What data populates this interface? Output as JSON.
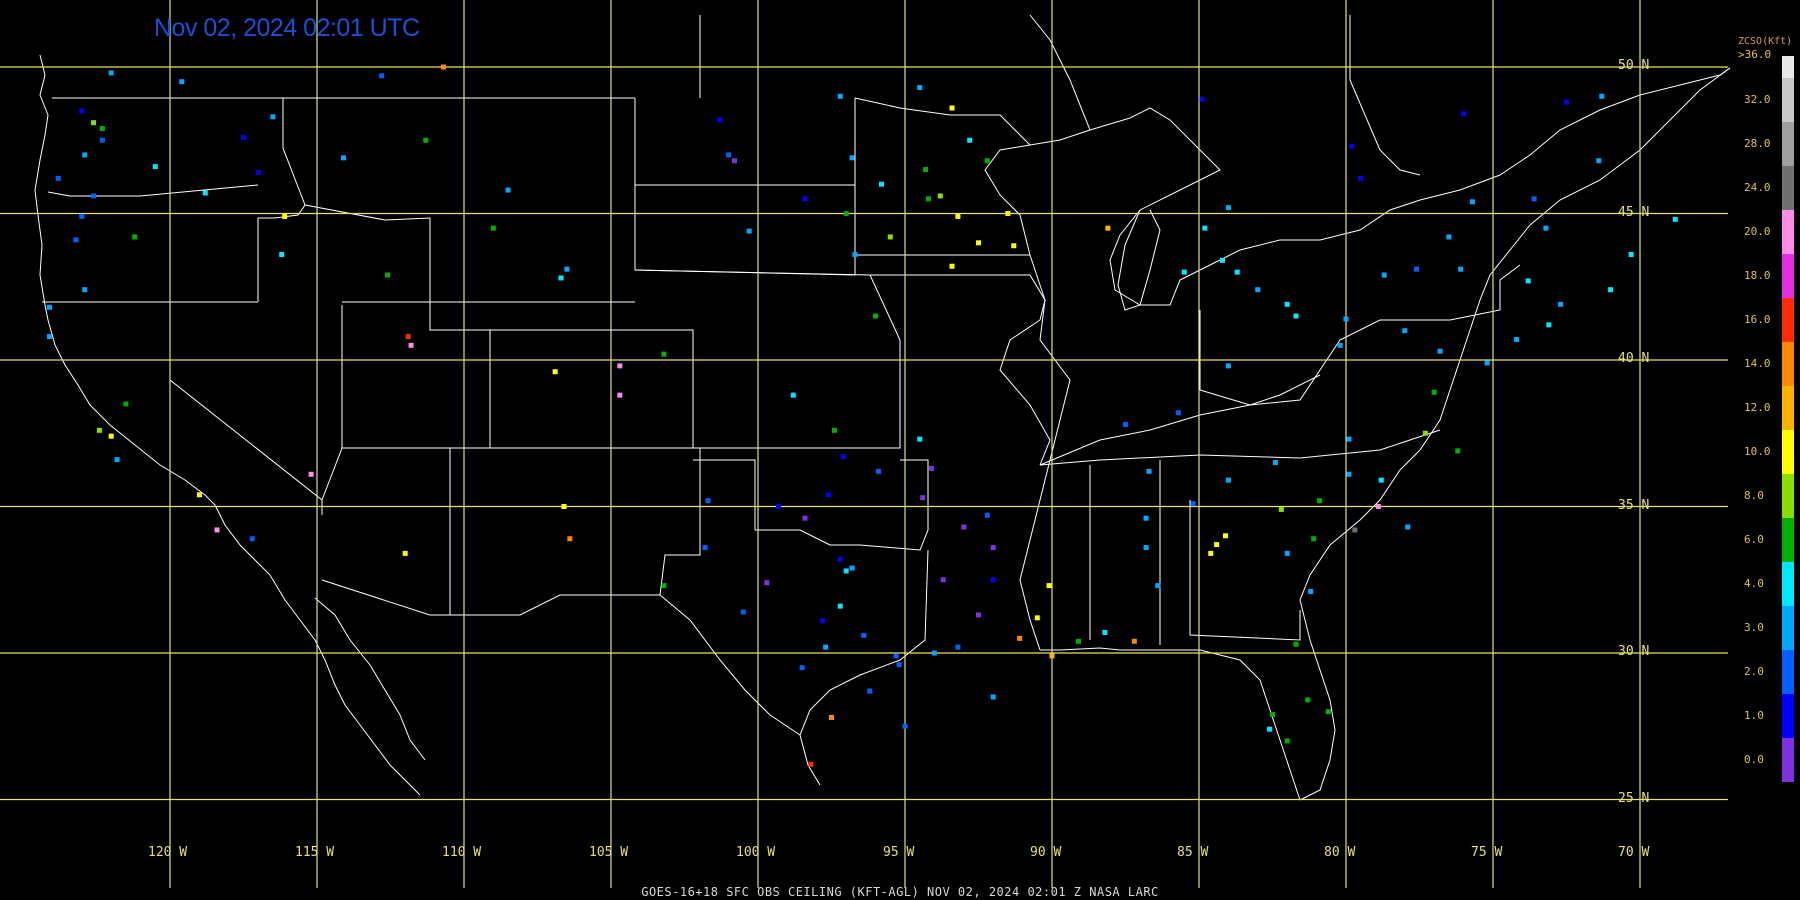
{
  "timestamp": "Nov 02, 2024 02:01 UTC",
  "footer": "GOES-16+18  SFC OBS CEILING (KFT-AGL)  NOV 02, 2024 02:01 Z  NASA LARC",
  "legend": {
    "title": "ZCSO(Kft)",
    "top_label": ">36.0",
    "levels": [
      {
        "label": "32.0",
        "color": "#c8c8c8"
      },
      {
        "label": "28.0",
        "color": "#a0a0a0"
      },
      {
        "label": "24.0",
        "color": "#707070"
      },
      {
        "label": "20.0",
        "color": "#ff8ce8"
      },
      {
        "label": "18.0",
        "color": "#e030e0"
      },
      {
        "label": "16.0",
        "color": "#ff2a00"
      },
      {
        "label": "14.0",
        "color": "#ff8800"
      },
      {
        "label": "12.0",
        "color": "#ffb000"
      },
      {
        "label": "10.0",
        "color": "#ffff00"
      },
      {
        "label": "8.0",
        "color": "#88e000"
      },
      {
        "label": "6.0",
        "color": "#00b000"
      },
      {
        "label": "4.0",
        "color": "#00e8ff"
      },
      {
        "label": "3.0",
        "color": "#00a8ff"
      },
      {
        "label": "2.0",
        "color": "#0060ff"
      },
      {
        "label": "1.0",
        "color": "#0000ff"
      },
      {
        "label": "0.0",
        "color": "#8030e0"
      }
    ]
  },
  "grid": {
    "latitudes": [
      "50 N",
      "45 N",
      "40 N",
      "35 N",
      "30 N",
      "25 N"
    ],
    "longitudes": [
      "120 W",
      "115 W",
      "110 W",
      "105 W",
      "100 W",
      "95 W",
      "90 W",
      "85 W",
      "80 W",
      "75 W",
      "70 W"
    ]
  },
  "stations": [
    {
      "lat": 48.5,
      "lon": -123.0,
      "v": 1.0
    },
    {
      "lat": 47.5,
      "lon": -122.3,
      "v": 2.0
    },
    {
      "lat": 47.0,
      "lon": -122.9,
      "v": 3.0
    },
    {
      "lat": 46.2,
      "lon": -123.8,
      "v": 2.0
    },
    {
      "lat": 45.6,
      "lon": -122.6,
      "v": 2.0
    },
    {
      "lat": 44.9,
      "lon": -123.0,
      "v": 2.0
    },
    {
      "lat": 44.1,
      "lon": -123.2,
      "v": 2.0
    },
    {
      "lat": 42.4,
      "lon": -122.9,
      "v": 3.0
    },
    {
      "lat": 41.8,
      "lon": -124.1,
      "v": 3.0
    },
    {
      "lat": 40.8,
      "lon": -124.1,
      "v": 3.0
    },
    {
      "lat": 48.1,
      "lon": -122.6,
      "v": 8.0
    },
    {
      "lat": 47.9,
      "lon": -122.3,
      "v": 6.0
    },
    {
      "lat": 46.6,
      "lon": -120.5,
      "v": 4.0
    },
    {
      "lat": 47.6,
      "lon": -117.5,
      "v": 1.0
    },
    {
      "lat": 46.4,
      "lon": -117.0,
      "v": 1.0
    },
    {
      "lat": 45.7,
      "lon": -118.8,
      "v": 4.0
    },
    {
      "lat": 44.2,
      "lon": -121.2,
      "v": 6.0
    },
    {
      "lat": 43.6,
      "lon": -116.2,
      "v": 4.0
    },
    {
      "lat": 42.9,
      "lon": -112.6,
      "v": 6.0
    },
    {
      "lat": 44.9,
      "lon": -116.1,
      "v": 10.0
    },
    {
      "lat": 46.9,
      "lon": -114.1,
      "v": 3.0
    },
    {
      "lat": 48.3,
      "lon": -116.5,
      "v": 3.0
    },
    {
      "lat": 47.5,
      "lon": -111.3,
      "v": 6.0
    },
    {
      "lat": 45.8,
      "lon": -108.5,
      "v": 3.0
    },
    {
      "lat": 44.5,
      "lon": -109.0,
      "v": 6.0
    },
    {
      "lat": 43.1,
      "lon": -106.5,
      "v": 3.0
    },
    {
      "lat": 42.8,
      "lon": -106.7,
      "v": 4.0
    },
    {
      "lat": 40.8,
      "lon": -111.9,
      "v": 16.0
    },
    {
      "lat": 40.5,
      "lon": -111.8,
      "v": 20.0
    },
    {
      "lat": 39.6,
      "lon": -106.9,
      "v": 10.0
    },
    {
      "lat": 39.8,
      "lon": -104.7,
      "v": 20.0
    },
    {
      "lat": 38.8,
      "lon": -104.7,
      "v": 20.0
    },
    {
      "lat": 40.2,
      "lon": -103.2,
      "v": 6.0
    },
    {
      "lat": 38.5,
      "lon": -121.5,
      "v": 6.0
    },
    {
      "lat": 37.6,
      "lon": -122.4,
      "v": 8.0
    },
    {
      "lat": 37.4,
      "lon": -122.0,
      "v": 10.0
    },
    {
      "lat": 36.6,
      "lon": -121.8,
      "v": 3.0
    },
    {
      "lat": 35.4,
      "lon": -119.0,
      "v": 10.0
    },
    {
      "lat": 34.2,
      "lon": -118.4,
      "v": 20.0
    },
    {
      "lat": 33.9,
      "lon": -117.2,
      "v": 2.0
    },
    {
      "lat": 36.1,
      "lon": -115.2,
      "v": 20.0
    },
    {
      "lat": 33.4,
      "lon": -112.0,
      "v": 10.0
    },
    {
      "lat": 35.0,
      "lon": -106.6,
      "v": 10.0
    },
    {
      "lat": 33.9,
      "lon": -106.4,
      "v": 14.0
    },
    {
      "lat": 32.3,
      "lon": -103.2,
      "v": 6.0
    },
    {
      "lat": 47.0,
      "lon": -101.0,
      "v": 2.0
    },
    {
      "lat": 46.8,
      "lon": -100.8,
      "v": 0.0
    },
    {
      "lat": 48.2,
      "lon": -101.3,
      "v": 1.0
    },
    {
      "lat": 46.9,
      "lon": -96.8,
      "v": 3.0
    },
    {
      "lat": 45.5,
      "lon": -98.4,
      "v": 1.0
    },
    {
      "lat": 44.4,
      "lon": -100.3,
      "v": 3.0
    },
    {
      "lat": 43.6,
      "lon": -96.7,
      "v": 3.0
    },
    {
      "lat": 46.8,
      "lon": -92.2,
      "v": 6.0
    },
    {
      "lat": 46.5,
      "lon": -94.3,
      "v": 6.0
    },
    {
      "lat": 45.5,
      "lon": -94.2,
      "v": 6.0
    },
    {
      "lat": 44.9,
      "lon": -93.2,
      "v": 10.0
    },
    {
      "lat": 44.0,
      "lon": -92.5,
      "v": 10.0
    },
    {
      "lat": 45.0,
      "lon": -91.5,
      "v": 10.0
    },
    {
      "lat": 44.5,
      "lon": -88.1,
      "v": 12.0
    },
    {
      "lat": 45.6,
      "lon": -93.8,
      "v": 8.0
    },
    {
      "lat": 44.2,
      "lon": -95.5,
      "v": 8.0
    },
    {
      "lat": 46.0,
      "lon": -95.8,
      "v": 4.0
    },
    {
      "lat": 45.0,
      "lon": -97.0,
      "v": 6.0
    },
    {
      "lat": 43.2,
      "lon": -93.4,
      "v": 10.0
    },
    {
      "lat": 43.9,
      "lon": -91.3,
      "v": 10.0
    },
    {
      "lat": 47.5,
      "lon": -92.8,
      "v": 4.0
    },
    {
      "lat": 48.6,
      "lon": -93.4,
      "v": 10.0
    },
    {
      "lat": 41.5,
      "lon": -96.0,
      "v": 6.0
    },
    {
      "lat": 45.2,
      "lon": -84.0,
      "v": 3.0
    },
    {
      "lat": 44.5,
      "lon": -84.8,
      "v": 4.0
    },
    {
      "lat": 43.0,
      "lon": -85.5,
      "v": 4.0
    },
    {
      "lat": 43.4,
      "lon": -84.2,
      "v": 4.0
    },
    {
      "lat": 43.0,
      "lon": -83.7,
      "v": 4.0
    },
    {
      "lat": 42.4,
      "lon": -83.0,
      "v": 3.0
    },
    {
      "lat": 41.9,
      "lon": -82.0,
      "v": 4.0
    },
    {
      "lat": 41.5,
      "lon": -81.7,
      "v": 4.0
    },
    {
      "lat": 41.4,
      "lon": -80.0,
      "v": 3.0
    },
    {
      "lat": 40.5,
      "lon": -80.2,
      "v": 3.0
    },
    {
      "lat": 41.0,
      "lon": -78.0,
      "v": 3.0
    },
    {
      "lat": 40.3,
      "lon": -76.8,
      "v": 3.0
    },
    {
      "lat": 42.9,
      "lon": -78.7,
      "v": 3.0
    },
    {
      "lat": 43.1,
      "lon": -77.6,
      "v": 2.0
    },
    {
      "lat": 43.1,
      "lon": -76.1,
      "v": 3.0
    },
    {
      "lat": 42.7,
      "lon": -73.8,
      "v": 4.0
    },
    {
      "lat": 44.5,
      "lon": -73.2,
      "v": 3.0
    },
    {
      "lat": 43.6,
      "lon": -70.3,
      "v": 4.0
    },
    {
      "lat": 44.8,
      "lon": -68.8,
      "v": 4.0
    },
    {
      "lat": 42.4,
      "lon": -71.0,
      "v": 4.0
    },
    {
      "lat": 41.9,
      "lon": -72.7,
      "v": 3.0
    },
    {
      "lat": 41.2,
      "lon": -73.1,
      "v": 4.0
    },
    {
      "lat": 40.7,
      "lon": -74.2,
      "v": 3.0
    },
    {
      "lat": 39.9,
      "lon": -75.2,
      "v": 3.0
    },
    {
      "lat": 38.9,
      "lon": -77.0,
      "v": 6.0
    },
    {
      "lat": 37.5,
      "lon": -77.3,
      "v": 8.0
    },
    {
      "lat": 36.9,
      "lon": -76.2,
      "v": 6.0
    },
    {
      "lat": 36.1,
      "lon": -79.9,
      "v": 3.0
    },
    {
      "lat": 35.2,
      "lon": -80.9,
      "v": 6.0
    },
    {
      "lat": 35.9,
      "lon": -78.8,
      "v": 4.0
    },
    {
      "lat": 35.0,
      "lon": -78.9,
      "v": 20.0
    },
    {
      "lat": 34.3,
      "lon": -77.9,
      "v": 3.0
    },
    {
      "lat": 34.9,
      "lon": -82.2,
      "v": 8.0
    },
    {
      "lat": 34.2,
      "lon": -79.7,
      "v": 24.0
    },
    {
      "lat": 33.9,
      "lon": -81.1,
      "v": 6.0
    },
    {
      "lat": 33.7,
      "lon": -84.4,
      "v": 10.0
    },
    {
      "lat": 34.0,
      "lon": -84.1,
      "v": 10.0
    },
    {
      "lat": 33.4,
      "lon": -84.6,
      "v": 10.0
    },
    {
      "lat": 33.4,
      "lon": -82.0,
      "v": 3.0
    },
    {
      "lat": 32.1,
      "lon": -81.2,
      "v": 3.0
    },
    {
      "lat": 30.3,
      "lon": -81.7,
      "v": 6.0
    },
    {
      "lat": 28.4,
      "lon": -81.3,
      "v": 6.0
    },
    {
      "lat": 27.9,
      "lon": -82.5,
      "v": 6.0
    },
    {
      "lat": 27.4,
      "lon": -82.6,
      "v": 4.0
    },
    {
      "lat": 28.0,
      "lon": -80.6,
      "v": 6.0
    },
    {
      "lat": 27.0,
      "lon": -82.0,
      "v": 6.0
    },
    {
      "lat": 35.1,
      "lon": -85.2,
      "v": 2.0
    },
    {
      "lat": 34.6,
      "lon": -86.8,
      "v": 3.0
    },
    {
      "lat": 33.6,
      "lon": -86.8,
      "v": 3.0
    },
    {
      "lat": 32.3,
      "lon": -86.4,
      "v": 3.0
    },
    {
      "lat": 30.7,
      "lon": -88.2,
      "v": 4.0
    },
    {
      "lat": 30.4,
      "lon": -87.2,
      "v": 14.0
    },
    {
      "lat": 30.4,
      "lon": -89.1,
      "v": 6.0
    },
    {
      "lat": 32.3,
      "lon": -90.1,
      "v": 10.0
    },
    {
      "lat": 31.2,
      "lon": -90.5,
      "v": 10.0
    },
    {
      "lat": 32.5,
      "lon": -93.7,
      "v": 0.0
    },
    {
      "lat": 32.5,
      "lon": -92.0,
      "v": 1.0
    },
    {
      "lat": 31.3,
      "lon": -92.5,
      "v": 0.0
    },
    {
      "lat": 30.2,
      "lon": -93.2,
      "v": 2.0
    },
    {
      "lat": 30.5,
      "lon": -91.1,
      "v": 14.0
    },
    {
      "lat": 29.9,
      "lon": -90.0,
      "v": 12.0
    },
    {
      "lat": 30.0,
      "lon": -94.0,
      "v": 3.0
    },
    {
      "lat": 29.6,
      "lon": -95.2,
      "v": 2.0
    },
    {
      "lat": 29.9,
      "lon": -95.3,
      "v": 2.0
    },
    {
      "lat": 30.6,
      "lon": -96.4,
      "v": 2.0
    },
    {
      "lat": 29.5,
      "lon": -98.5,
      "v": 2.0
    },
    {
      "lat": 30.2,
      "lon": -97.7,
      "v": 3.0
    },
    {
      "lat": 31.1,
      "lon": -97.8,
      "v": 1.0
    },
    {
      "lat": 32.8,
      "lon": -97.0,
      "v": 4.0
    },
    {
      "lat": 32.9,
      "lon": -96.8,
      "v": 3.0
    },
    {
      "lat": 33.2,
      "lon": -97.2,
      "v": 1.0
    },
    {
      "lat": 31.6,
      "lon": -97.2,
      "v": 4.0
    },
    {
      "lat": 32.4,
      "lon": -99.7,
      "v": 0.0
    },
    {
      "lat": 31.4,
      "lon": -100.5,
      "v": 2.0
    },
    {
      "lat": 33.6,
      "lon": -101.8,
      "v": 2.0
    },
    {
      "lat": 35.2,
      "lon": -101.7,
      "v": 2.0
    },
    {
      "lat": 35.4,
      "lon": -97.6,
      "v": 1.0
    },
    {
      "lat": 36.2,
      "lon": -95.9,
      "v": 2.0
    },
    {
      "lat": 34.6,
      "lon": -98.4,
      "v": 0.0
    },
    {
      "lat": 35.0,
      "lon": -99.3,
      "v": 1.0
    },
    {
      "lat": 36.7,
      "lon": -97.1,
      "v": 1.0
    },
    {
      "lat": 37.6,
      "lon": -97.4,
      "v": 6.0
    },
    {
      "lat": 38.8,
      "lon": -98.8,
      "v": 4.0
    },
    {
      "lat": 37.3,
      "lon": -94.5,
      "v": 4.0
    },
    {
      "lat": 35.3,
      "lon": -94.4,
      "v": 0.0
    },
    {
      "lat": 34.7,
      "lon": -92.2,
      "v": 2.0
    },
    {
      "lat": 36.3,
      "lon": -94.1,
      "v": 0.0
    },
    {
      "lat": 33.6,
      "lon": -92.0,
      "v": 0.0
    },
    {
      "lat": 34.3,
      "lon": -93.0,
      "v": 0.0
    },
    {
      "lat": 28.7,
      "lon": -96.2,
      "v": 2.0
    },
    {
      "lat": 27.8,
      "lon": -97.5,
      "v": 14.0
    },
    {
      "lat": 26.2,
      "lon": -98.2,
      "v": 16.0
    },
    {
      "lat": 28.5,
      "lon": -92.0,
      "v": 3.0
    },
    {
      "lat": 27.5,
      "lon": -95.0,
      "v": 2.0
    },
    {
      "lat": 36.2,
      "lon": -86.7,
      "v": 3.0
    },
    {
      "lat": 35.9,
      "lon": -84.0,
      "v": 3.0
    },
    {
      "lat": 36.5,
      "lon": -82.4,
      "v": 3.0
    },
    {
      "lat": 37.3,
      "lon": -79.9,
      "v": 3.0
    },
    {
      "lat": 38.2,
      "lon": -85.7,
      "v": 2.0
    },
    {
      "lat": 37.8,
      "lon": -87.5,
      "v": 2.0
    },
    {
      "lat": 39.8,
      "lon": -84.0,
      "v": 3.0
    },
    {
      "lat": 48.9,
      "lon": -84.9,
      "v": 1.0
    },
    {
      "lat": 47.3,
      "lon": -79.8,
      "v": 1.0
    },
    {
      "lat": 48.4,
      "lon": -76.0,
      "v": 1.0
    },
    {
      "lat": 48.8,
      "lon": -72.5,
      "v": 1.0
    },
    {
      "lat": 49.0,
      "lon": -71.3,
      "v": 3.0
    },
    {
      "lat": 46.2,
      "lon": -79.5,
      "v": 1.0
    },
    {
      "lat": 45.4,
      "lon": -75.7,
      "v": 3.0
    },
    {
      "lat": 46.8,
      "lon": -71.4,
      "v": 3.0
    },
    {
      "lat": 45.5,
      "lon": -73.6,
      "v": 2.0
    },
    {
      "lat": 44.2,
      "lon": -76.5,
      "v": 3.0
    },
    {
      "lat": 49.8,
      "lon": -122.0,
      "v": 3.0
    },
    {
      "lat": 49.5,
      "lon": -119.6,
      "v": 3.0
    },
    {
      "lat": 49.7,
      "lon": -112.8,
      "v": 2.0
    },
    {
      "lat": 50.0,
      "lon": -110.7,
      "v": 14.0
    },
    {
      "lat": 49.0,
      "lon": -97.2,
      "v": 3.0
    },
    {
      "lat": 49.3,
      "lon": -94.5,
      "v": 3.0
    }
  ]
}
